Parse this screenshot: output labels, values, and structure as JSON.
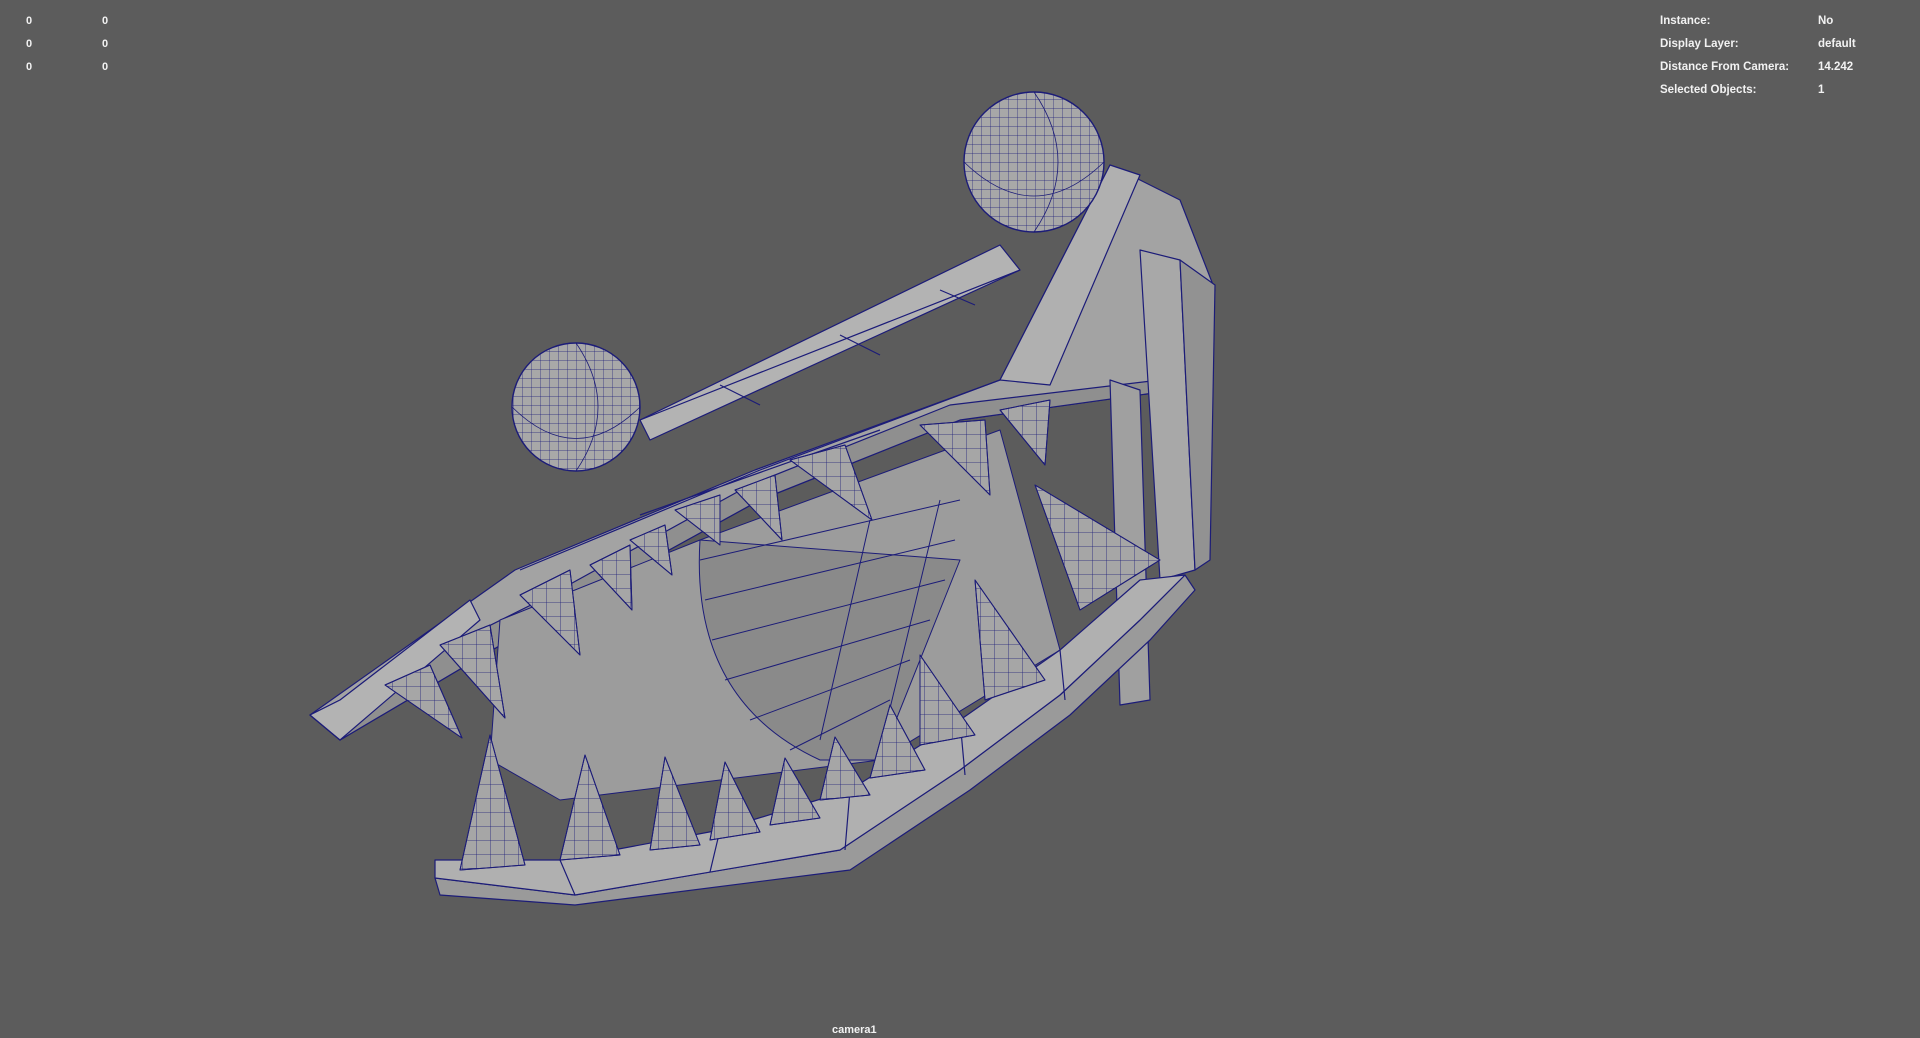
{
  "hud_left": {
    "rows": [
      {
        "a": "0",
        "b": "0"
      },
      {
        "a": "0",
        "b": "0"
      },
      {
        "a": "0",
        "b": "0"
      }
    ]
  },
  "hud_right": {
    "rows": [
      {
        "label": "Instance:",
        "value": "No"
      },
      {
        "label": "Display Layer:",
        "value": "default"
      },
      {
        "label": "Distance From Camera:",
        "value": "14.242"
      },
      {
        "label": "Selected Objects:",
        "value": "1"
      }
    ]
  },
  "camera_label": "camera1",
  "colors": {
    "background": "#5c5c5c",
    "mesh_fill": "#a3a3a3",
    "mesh_shade": "#8e8e8e",
    "wire": "#1c1c78",
    "hud_text": "#f2f2f2"
  }
}
